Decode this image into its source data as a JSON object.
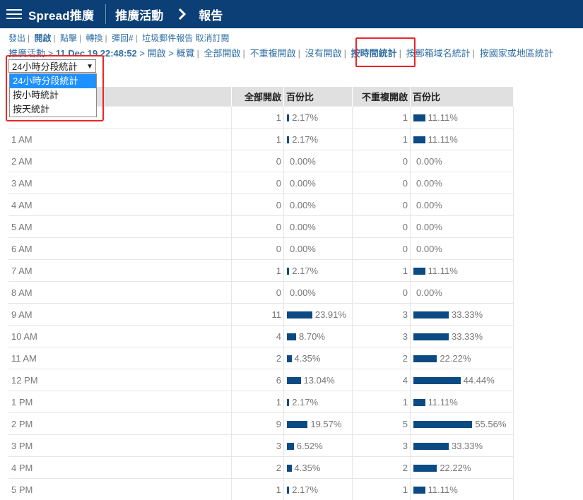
{
  "header": {
    "brand": "Spread推廣",
    "crumb1": "推廣活動",
    "crumb2": "報告",
    "bg_color": "#0b3f76"
  },
  "metrics_nav": {
    "items": [
      "發出",
      "開啟",
      "點擊",
      "轉換",
      "彈回#",
      "垃圾郵件報告",
      "取消訂閱"
    ]
  },
  "filter_nav": {
    "campaign": "推廣活動",
    "date": "11 Dec 19 22:48:52",
    "open": "開啟",
    "overview": "概覽",
    "links": [
      "全部開啟",
      "不重複開啟",
      "沒有開啟"
    ],
    "active": "按時間統計",
    "more": [
      "按郵箱域名統計",
      "按國家或地區統計"
    ]
  },
  "select": {
    "value": "24小時分段統計",
    "options": [
      "24小時分段統計",
      "按小時統計",
      "按天統計"
    ]
  },
  "table": {
    "headers": {
      "time": "",
      "opens": "全部開啟",
      "pct1": "百份比",
      "unique": "不重複開啟",
      "pct2": "百份比"
    },
    "rows": [
      {
        "time": "",
        "opens": 1,
        "pct1": 2.17,
        "unique": 1,
        "pct2": 11.11
      },
      {
        "time": "1 AM",
        "opens": 1,
        "pct1": 2.17,
        "unique": 1,
        "pct2": 11.11
      },
      {
        "time": "2 AM",
        "opens": 0,
        "pct1": 0.0,
        "unique": 0,
        "pct2": 0.0
      },
      {
        "time": "3 AM",
        "opens": 0,
        "pct1": 0.0,
        "unique": 0,
        "pct2": 0.0
      },
      {
        "time": "4 AM",
        "opens": 0,
        "pct1": 0.0,
        "unique": 0,
        "pct2": 0.0
      },
      {
        "time": "5 AM",
        "opens": 0,
        "pct1": 0.0,
        "unique": 0,
        "pct2": 0.0
      },
      {
        "time": "6 AM",
        "opens": 0,
        "pct1": 0.0,
        "unique": 0,
        "pct2": 0.0
      },
      {
        "time": "7 AM",
        "opens": 1,
        "pct1": 2.17,
        "unique": 1,
        "pct2": 11.11
      },
      {
        "time": "8 AM",
        "opens": 0,
        "pct1": 0.0,
        "unique": 0,
        "pct2": 0.0
      },
      {
        "time": "9 AM",
        "opens": 11,
        "pct1": 23.91,
        "unique": 3,
        "pct2": 33.33
      },
      {
        "time": "10 AM",
        "opens": 4,
        "pct1": 8.7,
        "unique": 3,
        "pct2": 33.33
      },
      {
        "time": "11 AM",
        "opens": 2,
        "pct1": 4.35,
        "unique": 2,
        "pct2": 22.22
      },
      {
        "time": "12 PM",
        "opens": 6,
        "pct1": 13.04,
        "unique": 4,
        "pct2": 44.44
      },
      {
        "time": "1 PM",
        "opens": 1,
        "pct1": 2.17,
        "unique": 1,
        "pct2": 11.11
      },
      {
        "time": "2 PM",
        "opens": 9,
        "pct1": 19.57,
        "unique": 5,
        "pct2": 55.56
      },
      {
        "time": "3 PM",
        "opens": 3,
        "pct1": 6.52,
        "unique": 3,
        "pct2": 33.33
      },
      {
        "time": "4 PM",
        "opens": 2,
        "pct1": 4.35,
        "unique": 2,
        "pct2": 22.22
      },
      {
        "time": "5 PM",
        "opens": 1,
        "pct1": 2.17,
        "unique": 1,
        "pct2": 11.11
      }
    ]
  }
}
